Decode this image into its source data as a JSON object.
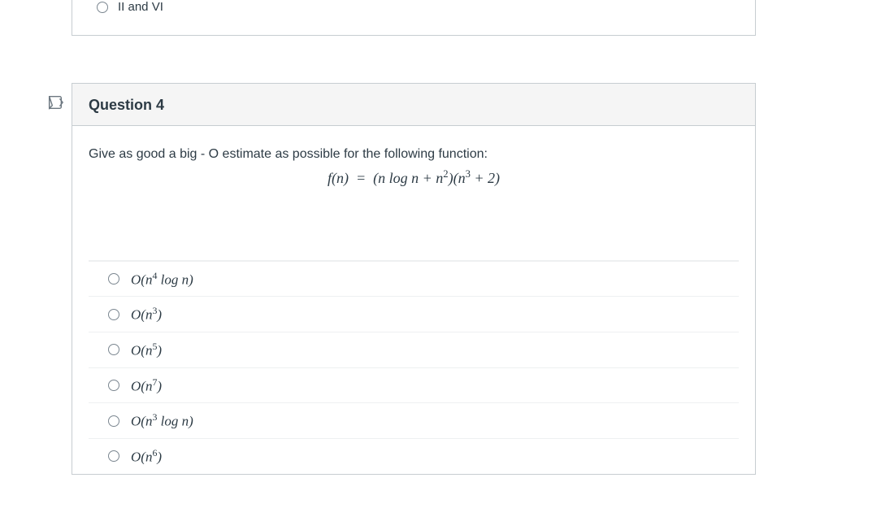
{
  "prev_question": {
    "trailing_option_label": "II and VI"
  },
  "question": {
    "heading": "Question 4",
    "prompt_prefix": "Give as good a ",
    "prompt_bold": "big - O",
    "prompt_suffix": " estimate as possible for the following function:",
    "formula": "f(n) = (n log n + n²)(n³ + 2)",
    "options": [
      "O(n⁴ log n)",
      "O(n³)",
      "O(n⁵)",
      "O(n⁷)",
      "O(n³ log n)",
      "O(n⁶)"
    ]
  }
}
